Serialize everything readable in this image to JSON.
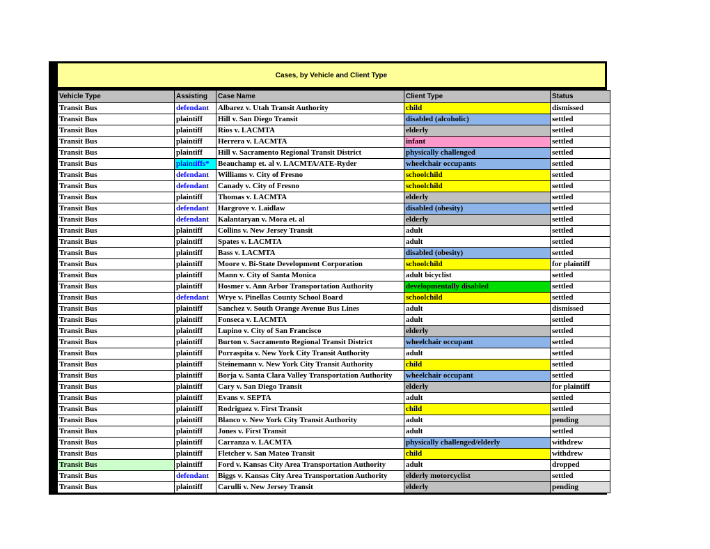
{
  "title_banner": {
    "text": "Cases, by Vehicle and Client Type"
  },
  "columns": [
    {
      "key": "vehicle",
      "label": "Vehicle Type",
      "align": "left"
    },
    {
      "key": "assist",
      "label": "Assisting",
      "align": "center"
    },
    {
      "key": "case",
      "label": "Case Name",
      "align": "center"
    },
    {
      "key": "client",
      "label": "Client Type",
      "align": "center"
    },
    {
      "key": "status",
      "label": "Status",
      "align": "center"
    }
  ],
  "colors": {
    "banner": "#ffff99",
    "header": "#c0c0c0",
    "yellow": "#ffff00",
    "blue": "#8cb4e8",
    "gray": "#c0c0c0",
    "pink": "#ff99cc",
    "green": "#00dd00",
    "cyan": "#00ffff",
    "light_green": "#ccffcc",
    "light_gray": "#dedede",
    "defendant_text": "#0000ff"
  },
  "rows": [
    {
      "vehicle": "Transit Bus",
      "vehicle_fill": "white",
      "assist": "defendant",
      "assist_fill": "white",
      "assist_style": "defendant",
      "case": "Albarez v. Utah Transit Authority",
      "client": "child",
      "client_fill": "yellow",
      "status": "dismissed",
      "status_fill": "white"
    },
    {
      "vehicle": "Transit Bus",
      "vehicle_fill": "white",
      "assist": "plaintiff",
      "assist_fill": "white",
      "assist_style": "plain",
      "case": "Hill v. San Diego Transit",
      "client": "disabled (alcoholic)",
      "client_fill": "blue",
      "status": "settled",
      "status_fill": "white"
    },
    {
      "vehicle": "Transit Bus",
      "vehicle_fill": "white",
      "assist": "plaintiff",
      "assist_fill": "white",
      "assist_style": "plain",
      "case": "Rios v. LACMTA",
      "client": "elderly",
      "client_fill": "gray",
      "status": "settled",
      "status_fill": "white"
    },
    {
      "vehicle": "Transit Bus",
      "vehicle_fill": "white",
      "assist": "plaintiff",
      "assist_fill": "white",
      "assist_style": "plain",
      "case": "Herrera v. LACMTA",
      "client": "infant",
      "client_fill": "pink",
      "status": "settled",
      "status_fill": "white"
    },
    {
      "vehicle": "Transit Bus",
      "vehicle_fill": "white",
      "assist": "plaintiff",
      "assist_fill": "white",
      "assist_style": "plain",
      "case": "Hill v. Sacramento Regional Transit District",
      "client": "physically challenged",
      "client_fill": "blue",
      "status": "settled",
      "status_fill": "white"
    },
    {
      "vehicle": "Transit Bus",
      "vehicle_fill": "white",
      "assist": "plaintiffs*",
      "assist_fill": "cyan",
      "assist_style": "defendant",
      "case": "Beauchamp et. al v. LACMTA/ATE-Ryder",
      "client": "wheelchair occupants",
      "client_fill": "blue",
      "status": "settled",
      "status_fill": "white"
    },
    {
      "vehicle": "Transit Bus",
      "vehicle_fill": "white",
      "assist": "defendant",
      "assist_fill": "white",
      "assist_style": "defendant",
      "case": "Williams v. City of Fresno",
      "client": "schoolchild",
      "client_fill": "yellow",
      "status": "settled",
      "status_fill": "white"
    },
    {
      "vehicle": "Transit Bus",
      "vehicle_fill": "white",
      "assist": "defendant",
      "assist_fill": "white",
      "assist_style": "defendant",
      "case": "Canady v. City of Fresno",
      "client": "schoolchild",
      "client_fill": "yellow",
      "status": "settled",
      "status_fill": "white"
    },
    {
      "vehicle": "Transit Bus",
      "vehicle_fill": "white",
      "assist": "plaintiff",
      "assist_fill": "white",
      "assist_style": "plain",
      "case": "Thomas v. LACMTA",
      "client": "elderly",
      "client_fill": "gray",
      "status": "settled",
      "status_fill": "white"
    },
    {
      "vehicle": "Transit Bus",
      "vehicle_fill": "white",
      "assist": "defendant",
      "assist_fill": "white",
      "assist_style": "defendant",
      "case": "Hargrove v. Laidlaw",
      "client": "disabled (obesity)",
      "client_fill": "blue",
      "status": "settled",
      "status_fill": "white"
    },
    {
      "vehicle": "Transit Bus",
      "vehicle_fill": "white",
      "assist": "defendant",
      "assist_fill": "white",
      "assist_style": "defendant",
      "case": "Kalantaryan v. Mora et. al",
      "client": "elderly",
      "client_fill": "gray",
      "status": "settled",
      "status_fill": "white"
    },
    {
      "vehicle": "Transit Bus",
      "vehicle_fill": "white",
      "assist": "plaintiff",
      "assist_fill": "white",
      "assist_style": "plain",
      "case": "Collins v. New Jersey Transit",
      "client": "adult",
      "client_fill": "white",
      "status": "settled",
      "status_fill": "white"
    },
    {
      "vehicle": "Transit Bus",
      "vehicle_fill": "white",
      "assist": "plaintiff",
      "assist_fill": "white",
      "assist_style": "plain",
      "case": "Spates v. LACMTA",
      "client": "adult",
      "client_fill": "white",
      "status": "settled",
      "status_fill": "white"
    },
    {
      "vehicle": "Transit Bus",
      "vehicle_fill": "white",
      "assist": "plaintiff",
      "assist_fill": "white",
      "assist_style": "plain",
      "case": "Bass v. LACMTA",
      "client": "disabled (obesity)",
      "client_fill": "blue",
      "status": "settled",
      "status_fill": "white"
    },
    {
      "vehicle": "Transit Bus",
      "vehicle_fill": "white",
      "assist": "plaintiff",
      "assist_fill": "white",
      "assist_style": "plain",
      "case": "Moore v. Bi-State Development Corporation",
      "client": "schoolchild",
      "client_fill": "yellow",
      "status": "for plaintiff",
      "status_fill": "white"
    },
    {
      "vehicle": "Transit Bus",
      "vehicle_fill": "white",
      "assist": "plaintiff",
      "assist_fill": "white",
      "assist_style": "plain",
      "case": "Mann v. City of Santa Monica",
      "client": "adult bicyclist",
      "client_fill": "white",
      "status": "settled",
      "status_fill": "white"
    },
    {
      "vehicle": "Transit Bus",
      "vehicle_fill": "white",
      "assist": "plaintiff",
      "assist_fill": "white",
      "assist_style": "plain",
      "case": "Hosmer v. Ann Arbor Transportation Authority",
      "client": "developmentally disabled",
      "client_fill": "green",
      "status": "settled",
      "status_fill": "white"
    },
    {
      "vehicle": "Transit Bus",
      "vehicle_fill": "white",
      "assist": "defendant",
      "assist_fill": "white",
      "assist_style": "defendant",
      "case": "Wrye v. Pinellas County School Board",
      "client": "schoolchild",
      "client_fill": "yellow",
      "status": "settled",
      "status_fill": "white"
    },
    {
      "vehicle": "Transit Bus",
      "vehicle_fill": "white",
      "assist": "plaintiff",
      "assist_fill": "white",
      "assist_style": "plain",
      "case": "Sanchez v. South Orange Avenue Bus Lines",
      "client": "adult",
      "client_fill": "white",
      "status": "dismissed",
      "status_fill": "white"
    },
    {
      "vehicle": "Transit Bus",
      "vehicle_fill": "white",
      "assist": "plaintiff",
      "assist_fill": "white",
      "assist_style": "plain",
      "case": "Fonseca v. LACMTA",
      "client": "adult",
      "client_fill": "white",
      "status": "settled",
      "status_fill": "white"
    },
    {
      "vehicle": "Transit Bus",
      "vehicle_fill": "white",
      "assist": "plaintiff",
      "assist_fill": "white",
      "assist_style": "plain",
      "case": "Lupino v. City of San Francisco",
      "client": "elderly",
      "client_fill": "gray",
      "status": "settled",
      "status_fill": "white"
    },
    {
      "vehicle": "Transit Bus",
      "vehicle_fill": "white",
      "assist": "plaintiff",
      "assist_fill": "white",
      "assist_style": "plain",
      "case": "Burton v. Sacramento Regional Transit District",
      "client": "wheelchair occupant",
      "client_fill": "blue",
      "status": "settled",
      "status_fill": "white"
    },
    {
      "vehicle": "Transit Bus",
      "vehicle_fill": "white",
      "assist": "plaintiff",
      "assist_fill": "white",
      "assist_style": "plain",
      "case": "Porraspita v. New York City Transit Authority",
      "client": "adult",
      "client_fill": "white",
      "status": "settled",
      "status_fill": "white"
    },
    {
      "vehicle": "Transit Bus",
      "vehicle_fill": "white",
      "assist": "plaintiff",
      "assist_fill": "white",
      "assist_style": "plain",
      "case": "Steinemann v. New York City Transit Authority",
      "client": "child",
      "client_fill": "yellow",
      "status": "settled",
      "status_fill": "white"
    },
    {
      "vehicle": "Transit Bus",
      "vehicle_fill": "white",
      "assist": "plaintiff",
      "assist_fill": "white",
      "assist_style": "plain",
      "case": "Borja v. Santa Clara Valley Transportation Authority",
      "client": "wheelchair occupant",
      "client_fill": "blue",
      "status": "settled",
      "status_fill": "white"
    },
    {
      "vehicle": "Transit Bus",
      "vehicle_fill": "white",
      "assist": "plaintiff",
      "assist_fill": "white",
      "assist_style": "plain",
      "case": "Cary v. San Diego Transit",
      "client": "elderly",
      "client_fill": "gray",
      "status": "for plaintiff",
      "status_fill": "white"
    },
    {
      "vehicle": "Transit Bus",
      "vehicle_fill": "white",
      "assist": "plaintiff",
      "assist_fill": "white",
      "assist_style": "plain",
      "case": "Evans v. SEPTA",
      "client": "adult",
      "client_fill": "white",
      "status": "settled",
      "status_fill": "white"
    },
    {
      "vehicle": "Transit Bus",
      "vehicle_fill": "white",
      "assist": "plaintiff",
      "assist_fill": "white",
      "assist_style": "plain",
      "case": "Rodriguez v. First Transit",
      "client": "child",
      "client_fill": "yellow",
      "status": "settled",
      "status_fill": "white"
    },
    {
      "vehicle": "Transit Bus",
      "vehicle_fill": "white",
      "assist": "plaintiff",
      "assist_fill": "white",
      "assist_style": "plain",
      "case": "Blanco v. New York City Transit Authority",
      "client": "adult",
      "client_fill": "white",
      "status": "pending",
      "status_fill": "light_gray"
    },
    {
      "vehicle": "Transit Bus",
      "vehicle_fill": "white",
      "assist": "plaintiff",
      "assist_fill": "white",
      "assist_style": "plain",
      "case": "Jones v. First Transit",
      "client": "adult",
      "client_fill": "white",
      "status": "settled",
      "status_fill": "white"
    },
    {
      "vehicle": "Transit Bus",
      "vehicle_fill": "white",
      "assist": "plaintiff",
      "assist_fill": "white",
      "assist_style": "plain",
      "case": "Carranza v. LACMTA",
      "client": "physically challenged/elderly",
      "client_fill": "blue",
      "status": "withdrew",
      "status_fill": "white"
    },
    {
      "vehicle": "Transit Bus",
      "vehicle_fill": "white",
      "assist": "plaintiff",
      "assist_fill": "white",
      "assist_style": "plain",
      "case": "Fletcher v. San Mateo Transit",
      "client": "child",
      "client_fill": "yellow",
      "status": "withdrew",
      "status_fill": "white"
    },
    {
      "vehicle": "Transit Bus",
      "vehicle_fill": "light_green",
      "assist": "plaintiff",
      "assist_fill": "white",
      "assist_style": "plain",
      "case": "Ford v. Kansas City Area Transportation Authority",
      "client": "adult",
      "client_fill": "white",
      "status": "dropped",
      "status_fill": "white"
    },
    {
      "vehicle": "Transit Bus",
      "vehicle_fill": "white",
      "assist": "defendant",
      "assist_fill": "white",
      "assist_style": "defendant",
      "case": "Biggs v. Kansas City Area Transportation Authority",
      "client": "elderly motorcyclist",
      "client_fill": "gray",
      "status": "settled",
      "status_fill": "white"
    },
    {
      "vehicle": "Transit Bus",
      "vehicle_fill": "white",
      "assist": "plaintiff",
      "assist_fill": "white",
      "assist_style": "plain",
      "case": "Carulli v. New Jersey Transit",
      "client": "elderly",
      "client_fill": "gray",
      "status": "pending",
      "status_fill": "light_gray"
    }
  ]
}
